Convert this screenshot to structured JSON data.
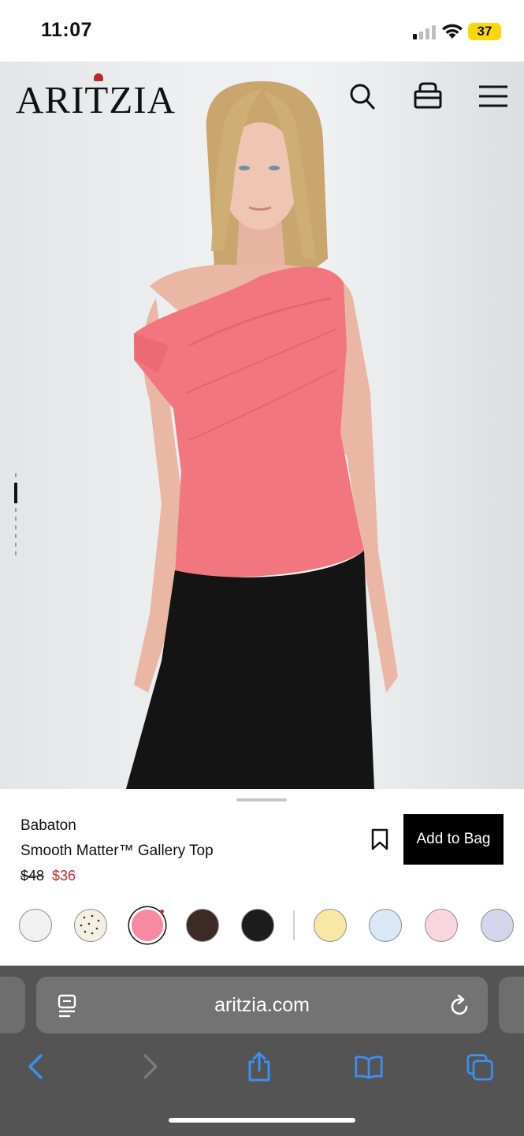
{
  "status_bar": {
    "time": "11:07",
    "battery": "37"
  },
  "header": {
    "logo": "ARITZIA"
  },
  "product": {
    "brand": "Babaton",
    "name": "Smooth Matter™ Gallery Top",
    "price_original": "$48",
    "price_sale": "$36",
    "add_to_bag_label": "Add to Bag"
  },
  "swatches": [
    {
      "name": "white",
      "color": "#f1f1f1"
    },
    {
      "name": "polka-dot",
      "color": "#f3efe1"
    },
    {
      "name": "pink",
      "color": "#f58aa0",
      "selected": true
    },
    {
      "name": "brown",
      "color": "#3b2a25"
    },
    {
      "name": "black",
      "color": "#1c1c1c"
    },
    {
      "name": "yellow",
      "color": "#f7e8a6"
    },
    {
      "name": "light-blue",
      "color": "#d8e8f6"
    },
    {
      "name": "light-pink",
      "color": "#f9d6df"
    },
    {
      "name": "lavender",
      "color": "#d6d4ea"
    }
  ],
  "browser": {
    "url": "aritzia.com"
  },
  "colors": {
    "accent_sale": "#d2232a",
    "safari_blue": "#3d8ff0",
    "top_pink": "#f2767f"
  }
}
